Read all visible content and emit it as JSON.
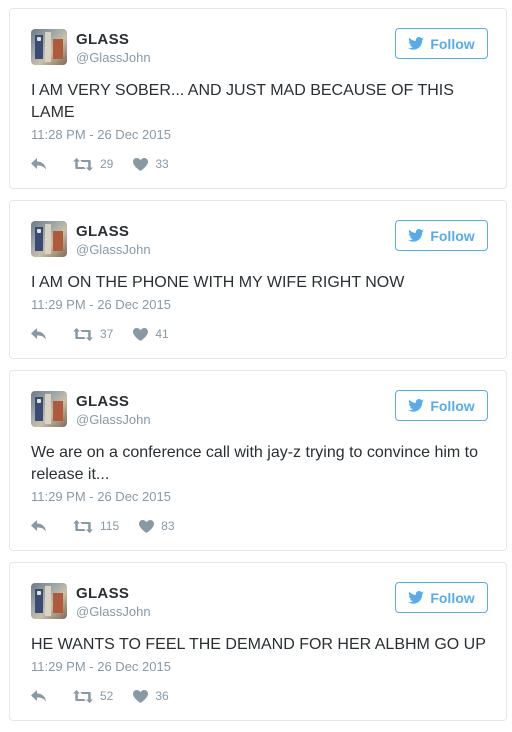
{
  "follow_label": "Follow",
  "tweets": [
    {
      "name": "GLASS",
      "handle": "@GlassJohn",
      "text": "I AM VERY SOBER... AND JUST MAD BECAUSE OF THIS LAME",
      "time": "11:28 PM - 26 Dec 2015",
      "retweets": "29",
      "likes": "33"
    },
    {
      "name": "GLASS",
      "handle": "@GlassJohn",
      "text": "I AM ON THE PHONE WITH MY WIFE RIGHT NOW",
      "time": "11:29 PM - 26 Dec 2015",
      "retweets": "37",
      "likes": "41"
    },
    {
      "name": "GLASS",
      "handle": "@GlassJohn",
      "text": "We are on a conference call with jay-z trying to convince him to release it...",
      "time": "11:29 PM - 26 Dec 2015",
      "retweets": "115",
      "likes": "83"
    },
    {
      "name": "GLASS",
      "handle": "@GlassJohn",
      "text": "HE WANTS TO FEEL THE DEMAND FOR HER ALBHM GO UP",
      "time": "11:29 PM - 26 Dec 2015",
      "retweets": "52",
      "likes": "36"
    }
  ],
  "colors": {
    "accent": "#55acee",
    "muted": "#8899a6",
    "text": "#292f33",
    "border": "#e1e8ed"
  },
  "icons": {
    "reply": "reply-icon",
    "retweet": "retweet-icon",
    "like": "heart-icon",
    "follow": "twitter-bird-icon"
  }
}
